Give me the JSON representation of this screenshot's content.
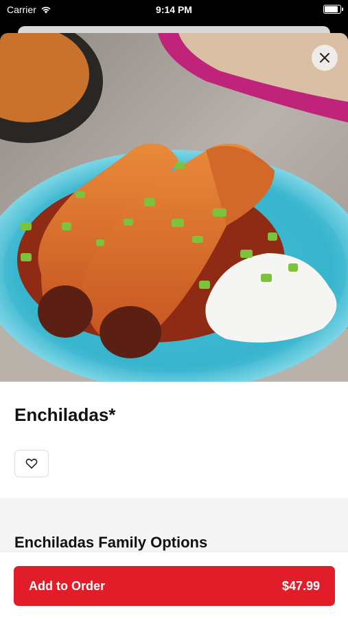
{
  "status_bar": {
    "carrier": "Carrier",
    "time": "9:14 PM",
    "battery_level": 0.85,
    "icons": [
      "wifi-icon",
      "battery-icon"
    ]
  },
  "item": {
    "name": "Enchiladas*",
    "image_icon": "enchiladas-photo"
  },
  "actions": {
    "close_icon": "close-icon",
    "favorite_icon": "heart-icon"
  },
  "options": {
    "section_title": "Enchiladas Family Options"
  },
  "footer": {
    "add_label": "Add to Order",
    "price": "$47.99"
  },
  "colors": {
    "accent": "#e11d2a"
  }
}
